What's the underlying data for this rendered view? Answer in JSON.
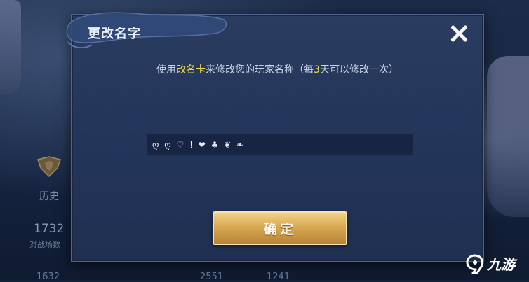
{
  "dialog": {
    "title": "更改名字",
    "description": {
      "part1": "使用",
      "card_name": "改名卡",
      "part2": "来修改您的玩家名称（每",
      "days": "3",
      "part3": "天可以修改一次）"
    },
    "name_input_value": "ღ ღ ♡ ! ❤ ♣ ❦ ❧",
    "confirm_label": "确定"
  },
  "background": {
    "history_label": "历史",
    "stat_value": "1732",
    "stat_sub": "对战场数",
    "bottom_values": [
      "1632",
      "2551",
      "1241"
    ]
  },
  "watermark": {
    "text": "九游"
  },
  "colors": {
    "highlight": "#e9d94d",
    "button_gold": "#d9a952",
    "dialog_bg": "#23355a"
  }
}
